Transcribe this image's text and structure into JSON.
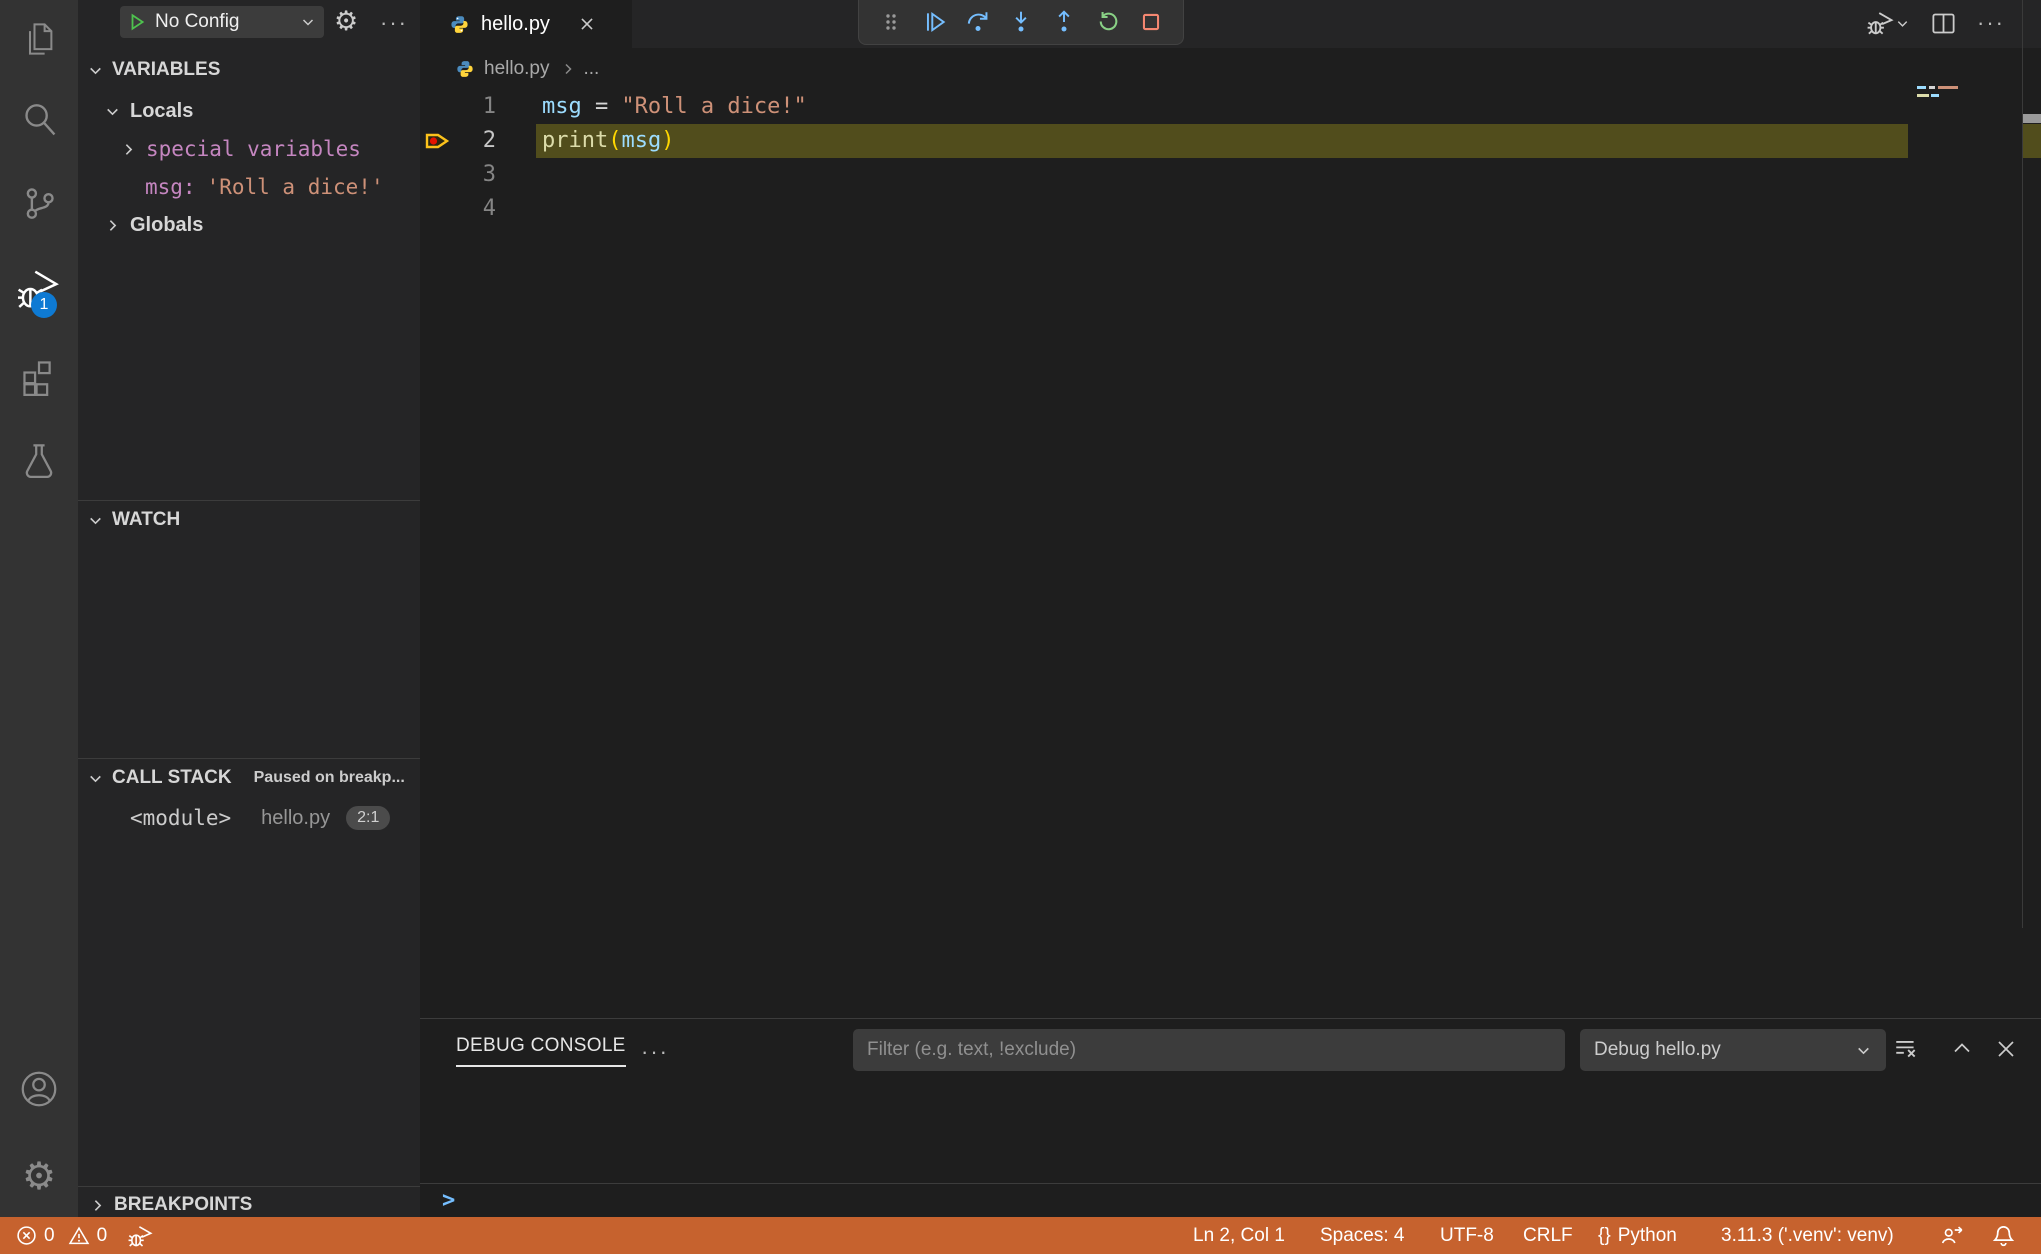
{
  "colors": {
    "status_bar_debugging": "#c6622e",
    "activity_badge": "#0e7ad3",
    "debug_line_highlight": "#514d1c",
    "step_icon_blue": "#75beff",
    "restart_green": "#89d185",
    "stop_red": "#f48771",
    "variable_blue": "#9cdcfe",
    "string_orange": "#ce9178",
    "function_yellow": "#dcdcaa",
    "member_purple": "#c586c0"
  },
  "activity_bar": {
    "debug_badge": "1"
  },
  "sidebar": {
    "debug_toolbar": {
      "config_label": "No Config",
      "more_label": "···"
    },
    "variables": {
      "title": "VARIABLES",
      "locals_label": "Locals",
      "special_label": "special variables",
      "msg_name": "msg:",
      "msg_value": "'Roll a dice!'",
      "globals_label": "Globals"
    },
    "watch": {
      "title": "WATCH"
    },
    "call_stack": {
      "title": "CALL STACK",
      "status": "Paused on breakp...",
      "frame_name": "<module>",
      "frame_file": "hello.py",
      "frame_position": "2:1"
    },
    "breakpoints": {
      "title": "BREAKPOINTS"
    }
  },
  "editor": {
    "tab_label": "hello.py",
    "breadcrumb_file": "hello.py",
    "breadcrumb_more": "...",
    "code": {
      "l1_num": "1",
      "l1_var": "msg",
      "l1_op": "=",
      "l1_str": "\"Roll a dice!\"",
      "l2_num": "2",
      "l2_fn": "print",
      "l2_open": "(",
      "l2_arg": "msg",
      "l2_close": ")",
      "l3_num": "3",
      "l4_num": "4"
    }
  },
  "panel": {
    "tab_label": "DEBUG CONSOLE",
    "more_label": "···",
    "filter_placeholder": "Filter (e.g. text, !exclude)",
    "session_label": "Debug hello.py",
    "prompt": ">"
  },
  "status_bar": {
    "errors": "0",
    "warnings": "0",
    "cursor": "Ln 2, Col 1",
    "indent": "Spaces: 4",
    "encoding": "UTF-8",
    "eol": "CRLF",
    "braces": "{}",
    "language": "Python",
    "interpreter": "3.11.3 ('.venv': venv)"
  }
}
